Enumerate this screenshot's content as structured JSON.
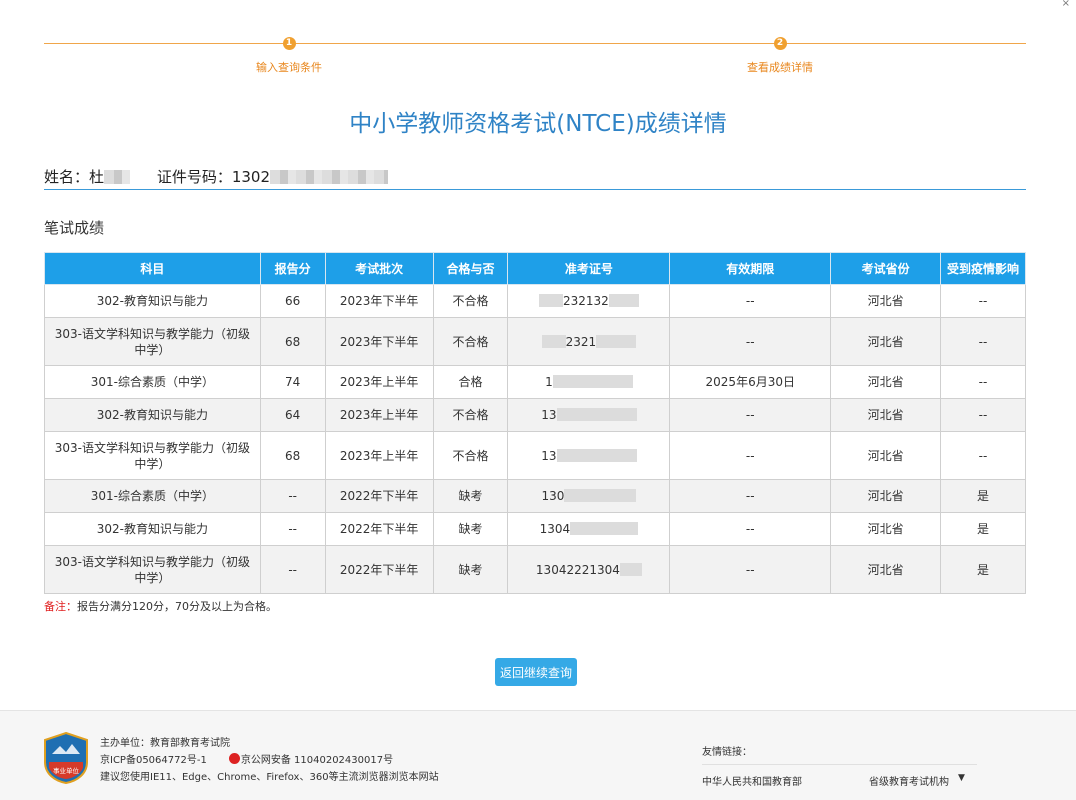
{
  "steps": [
    {
      "num": "1",
      "label": "输入查询条件"
    },
    {
      "num": "2",
      "label": "查看成绩详情"
    }
  ],
  "title": "中小学教师资格考试(NTCE)成绩详情",
  "info": {
    "name_label": "姓名：",
    "name_value": "杜",
    "id_label": "证件号码：",
    "id_value": "1302"
  },
  "section_title": "笔试成绩",
  "table": {
    "headers": [
      "科目",
      "报告分",
      "考试批次",
      "合格与否",
      "准考证号",
      "有效期限",
      "考试省份",
      "受到疫情影响"
    ],
    "rows": [
      {
        "subject": "302-教育知识与能力",
        "score": "66",
        "batch": "2023年下半年",
        "pass": "不合格",
        "ticket": "232132",
        "expiry": "--",
        "province": "河北省",
        "covid": "--"
      },
      {
        "subject": "303-语文学科知识与教学能力（初级中学）",
        "score": "68",
        "batch": "2023年下半年",
        "pass": "不合格",
        "ticket": "2321",
        "expiry": "--",
        "province": "河北省",
        "covid": "--"
      },
      {
        "subject": "301-综合素质（中学）",
        "score": "74",
        "batch": "2023年上半年",
        "pass": "合格",
        "ticket": "1",
        "expiry": "2025年6月30日",
        "province": "河北省",
        "covid": "--"
      },
      {
        "subject": "302-教育知识与能力",
        "score": "64",
        "batch": "2023年上半年",
        "pass": "不合格",
        "ticket": "13",
        "expiry": "--",
        "province": "河北省",
        "covid": "--"
      },
      {
        "subject": "303-语文学科知识与教学能力（初级中学）",
        "score": "68",
        "batch": "2023年上半年",
        "pass": "不合格",
        "ticket": "13",
        "expiry": "--",
        "province": "河北省",
        "covid": "--"
      },
      {
        "subject": "301-综合素质（中学）",
        "score": "--",
        "batch": "2022年下半年",
        "pass": "缺考",
        "ticket": "130",
        "expiry": "--",
        "province": "河北省",
        "covid": "是"
      },
      {
        "subject": "302-教育知识与能力",
        "score": "--",
        "batch": "2022年下半年",
        "pass": "缺考",
        "ticket": "1304",
        "expiry": "--",
        "province": "河北省",
        "covid": "是"
      },
      {
        "subject": "303-语文学科知识与教学能力（初级中学）",
        "score": "--",
        "batch": "2022年下半年",
        "pass": "缺考",
        "ticket": "13042221304",
        "expiry": "--",
        "province": "河北省",
        "covid": "是"
      }
    ]
  },
  "note": {
    "label": "备注：",
    "text": "报告分满分120分，70分及以上为合格。"
  },
  "back_button": "返回继续查询",
  "footer": {
    "badge_text": "事业单位",
    "host": "主办单位：教育部教育考试院",
    "icp": "京ICP备05064772号-1",
    "police": "京公网安备 11040202430017号",
    "browser_tip": "建议您使用IE11、Edge、Chrome、Firefox、360等主流浏览器浏览本网站",
    "links_title": "友情链接：",
    "link_moe": "中华人民共和国教育部",
    "link_province": "省级教育考试机构"
  },
  "colors": {
    "accent_orange": "#f0a030",
    "title_blue": "#2f83c6",
    "header_blue": "#1e9fe8",
    "note_red": "#e02020"
  }
}
